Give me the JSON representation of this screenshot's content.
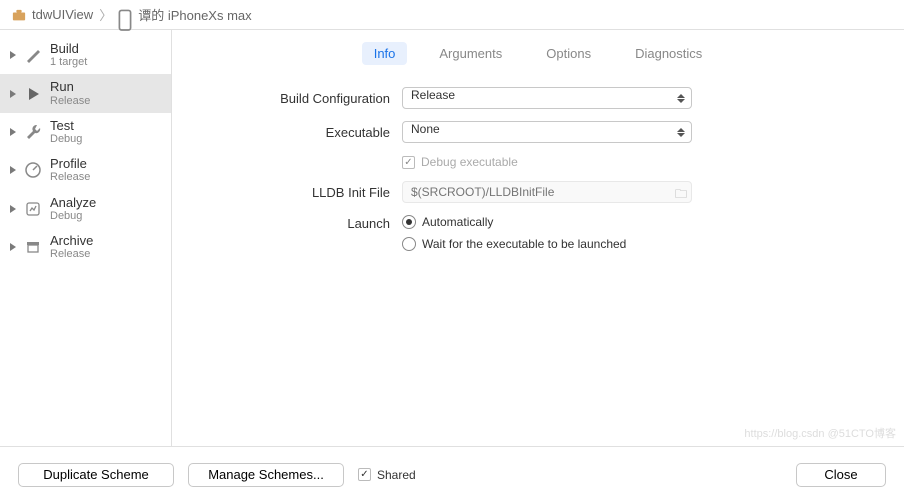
{
  "breadcrumb": {
    "project": "tdwUIView",
    "target": "谭的 iPhoneXs max"
  },
  "sidebar": [
    {
      "title": "Build",
      "sub": "1 target",
      "icon": "hammer"
    },
    {
      "title": "Run",
      "sub": "Release",
      "icon": "play",
      "selected": true
    },
    {
      "title": "Test",
      "sub": "Debug",
      "icon": "wrench"
    },
    {
      "title": "Profile",
      "sub": "Release",
      "icon": "gauge"
    },
    {
      "title": "Analyze",
      "sub": "Debug",
      "icon": "analyze"
    },
    {
      "title": "Archive",
      "sub": "Release",
      "icon": "archive"
    }
  ],
  "tabs": {
    "items": [
      "Info",
      "Arguments",
      "Options",
      "Diagnostics"
    ],
    "active": 0
  },
  "form": {
    "build_config": {
      "label": "Build Configuration",
      "value": "Release"
    },
    "executable": {
      "label": "Executable",
      "value": "None"
    },
    "debug_exec": {
      "label": "Debug executable",
      "checked": true,
      "enabled": false
    },
    "lldb": {
      "label": "LLDB Init File",
      "placeholder": "$(SRCROOT)/LLDBInitFile"
    },
    "launch": {
      "label": "Launch",
      "auto": "Automatically",
      "wait": "Wait for the executable to be launched",
      "selected": "auto"
    }
  },
  "footer": {
    "duplicate": "Duplicate Scheme",
    "manage": "Manage Schemes...",
    "shared_label": "Shared",
    "shared_checked": true,
    "close": "Close"
  },
  "watermark": "https://blog.csdn @51CTO博客"
}
